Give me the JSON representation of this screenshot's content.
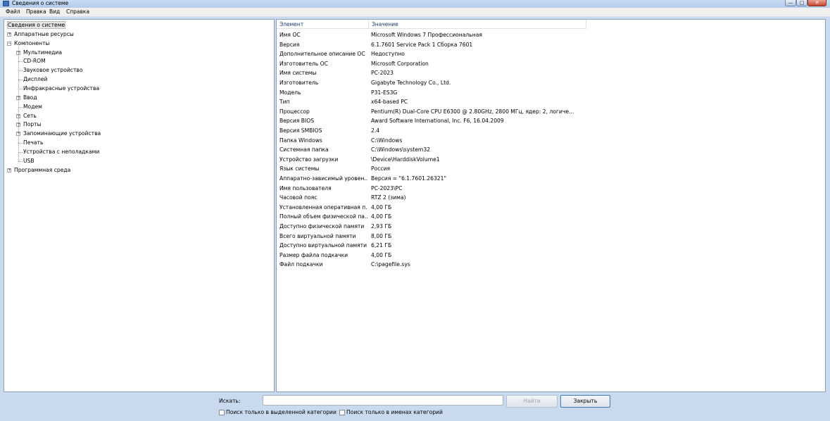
{
  "window": {
    "title": "Сведения о системе",
    "min_glyph": "—",
    "max_glyph": "□",
    "close_glyph": "✕"
  },
  "menu": [
    "Файл",
    "Правка",
    "Вид",
    "Справка"
  ],
  "tree": [
    {
      "label": "Сведения о системе",
      "level": 0,
      "expander": "",
      "selected": true
    },
    {
      "label": "Аппаратные ресурсы",
      "level": 0,
      "expander": "+"
    },
    {
      "label": "Компоненты",
      "level": 0,
      "expander": "-"
    },
    {
      "label": "Мультимедиа",
      "level": 1,
      "expander": "+"
    },
    {
      "label": "CD-ROM",
      "level": 1,
      "expander": ""
    },
    {
      "label": "Звуковое устройство",
      "level": 1,
      "expander": ""
    },
    {
      "label": "Дисплей",
      "level": 1,
      "expander": ""
    },
    {
      "label": "Инфракрасные устройства",
      "level": 1,
      "expander": ""
    },
    {
      "label": "Ввод",
      "level": 1,
      "expander": "+"
    },
    {
      "label": "Модем",
      "level": 1,
      "expander": ""
    },
    {
      "label": "Сеть",
      "level": 1,
      "expander": "+"
    },
    {
      "label": "Порты",
      "level": 1,
      "expander": "+"
    },
    {
      "label": "Запоминающие устройства",
      "level": 1,
      "expander": "+"
    },
    {
      "label": "Печать",
      "level": 1,
      "expander": ""
    },
    {
      "label": "Устройства с неполадками",
      "level": 1,
      "expander": ""
    },
    {
      "label": "USB",
      "level": 1,
      "expander": ""
    },
    {
      "label": "Программная среда",
      "level": 0,
      "expander": "+"
    }
  ],
  "table": {
    "columns": [
      "Элемент",
      "Значение"
    ],
    "rows": [
      [
        "Имя ОС",
        "Microsoft Windows 7 Профессиональная"
      ],
      [
        "Версия",
        "6.1.7601 Service Pack 1 Сборка 7601"
      ],
      [
        "Дополнительное описание ОС",
        "Недоступно"
      ],
      [
        "Изготовитель ОС",
        "Microsoft Corporation"
      ],
      [
        "Имя системы",
        "PC-2023"
      ],
      [
        "Изготовитель",
        "Gigabyte Technology Co., Ltd."
      ],
      [
        "Модель",
        "P31-ES3G"
      ],
      [
        "Тип",
        "x64-based PC"
      ],
      [
        "Процессор",
        "Pentium(R) Dual-Core  CPU      E6300  @ 2.80GHz, 2800 МГц, ядер: 2, логиче..."
      ],
      [
        "Версия BIOS",
        "Award Software International, Inc. F6, 16.04.2009"
      ],
      [
        "Версия SMBIOS",
        "2.4"
      ],
      [
        "Папка Windows",
        "C:\\Windows"
      ],
      [
        "Системная папка",
        "C:\\Windows\\system32"
      ],
      [
        "Устройство загрузки",
        "\\Device\\HarddiskVolume1"
      ],
      [
        "Язык системы",
        "Россия"
      ],
      [
        "Аппаратно-зависимый уровен...",
        "Версия = \"6.1.7601.26321\""
      ],
      [
        "Имя пользователя",
        "PC-2023\\PC"
      ],
      [
        "Часовой пояс",
        "RTZ 2 (зима)"
      ],
      [
        "Установленная оперативная п...",
        "4,00 ГБ"
      ],
      [
        "Полный объем физической па...",
        "4,00 ГБ"
      ],
      [
        "Доступно физической памяти",
        "2,93 ГБ"
      ],
      [
        "Всего виртуальной памяти",
        "8,00 ГБ"
      ],
      [
        "Доступно виртуальной памяти",
        "6,21 ГБ"
      ],
      [
        "Размер файла подкачки",
        "4,00 ГБ"
      ],
      [
        "Файл подкачки",
        "C:\\pagefile.sys"
      ]
    ]
  },
  "search": {
    "label": "Искать:",
    "value": "",
    "find_button": "Найти",
    "close_button": "Закрыть",
    "option_selected_category": "Поиск только в выделенной категории",
    "option_category_names": "Поиск только в именах категорий"
  }
}
